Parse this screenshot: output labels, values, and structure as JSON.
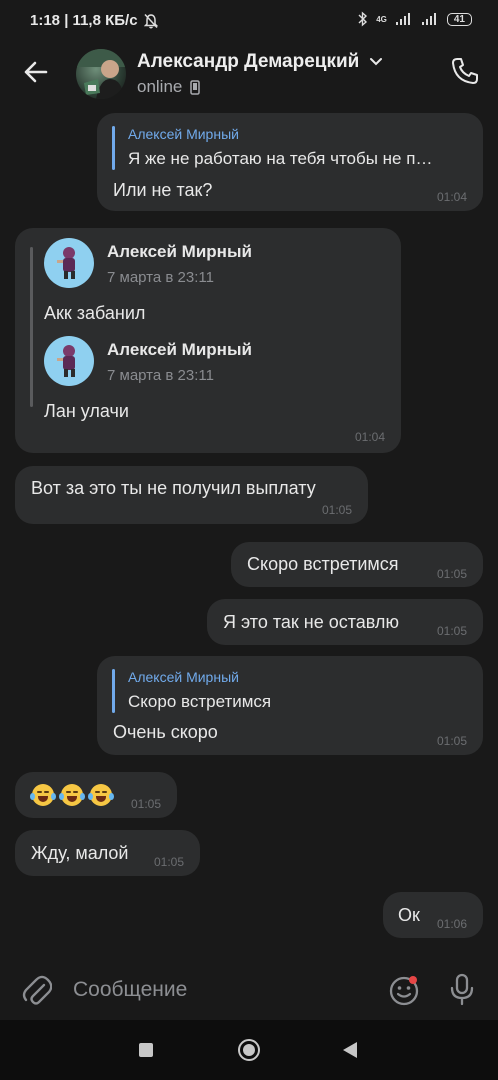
{
  "status_bar": {
    "time_speed": "1:18 | 11,8 КБ/с",
    "network": "4G",
    "battery": "41"
  },
  "header": {
    "name": "Александр Демарецкий",
    "status": "online"
  },
  "messages": [
    {
      "reply_name": "Алексей Мирный",
      "reply_text": "Я же не работаю на тебя чтобы не п…",
      "text": "Или не так?",
      "time": "01:04"
    },
    {
      "forwarded": [
        {
          "name": "Алексей Мирный",
          "date": "7 марта в 23:11",
          "text": "Акк забанил"
        },
        {
          "name": "Алексей Мирный",
          "date": "7 марта в 23:11",
          "text": "Лан улачи"
        }
      ],
      "time": "01:04"
    },
    {
      "text": "Вот за это ты не получил выплату",
      "time": "01:05"
    },
    {
      "text": "Скоро встретимся",
      "time": "01:05"
    },
    {
      "text": "Я это так не оставлю",
      "time": "01:05"
    },
    {
      "reply_name": "Алексей Мирный",
      "reply_text": "Скоро встретимся",
      "text": "Очень скоро",
      "time": "01:05"
    },
    {
      "emoji": [
        "joy",
        "joy",
        "joy"
      ],
      "time": "01:05"
    },
    {
      "text": "Жду, малой",
      "time": "01:05"
    },
    {
      "text": "Ок",
      "time": "01:06"
    }
  ],
  "composer": {
    "placeholder": "Сообщение"
  },
  "colors": {
    "background": "#191919",
    "bubble": "#2c2d2e",
    "accent": "#71aaeb",
    "time": "#6b6d70"
  }
}
